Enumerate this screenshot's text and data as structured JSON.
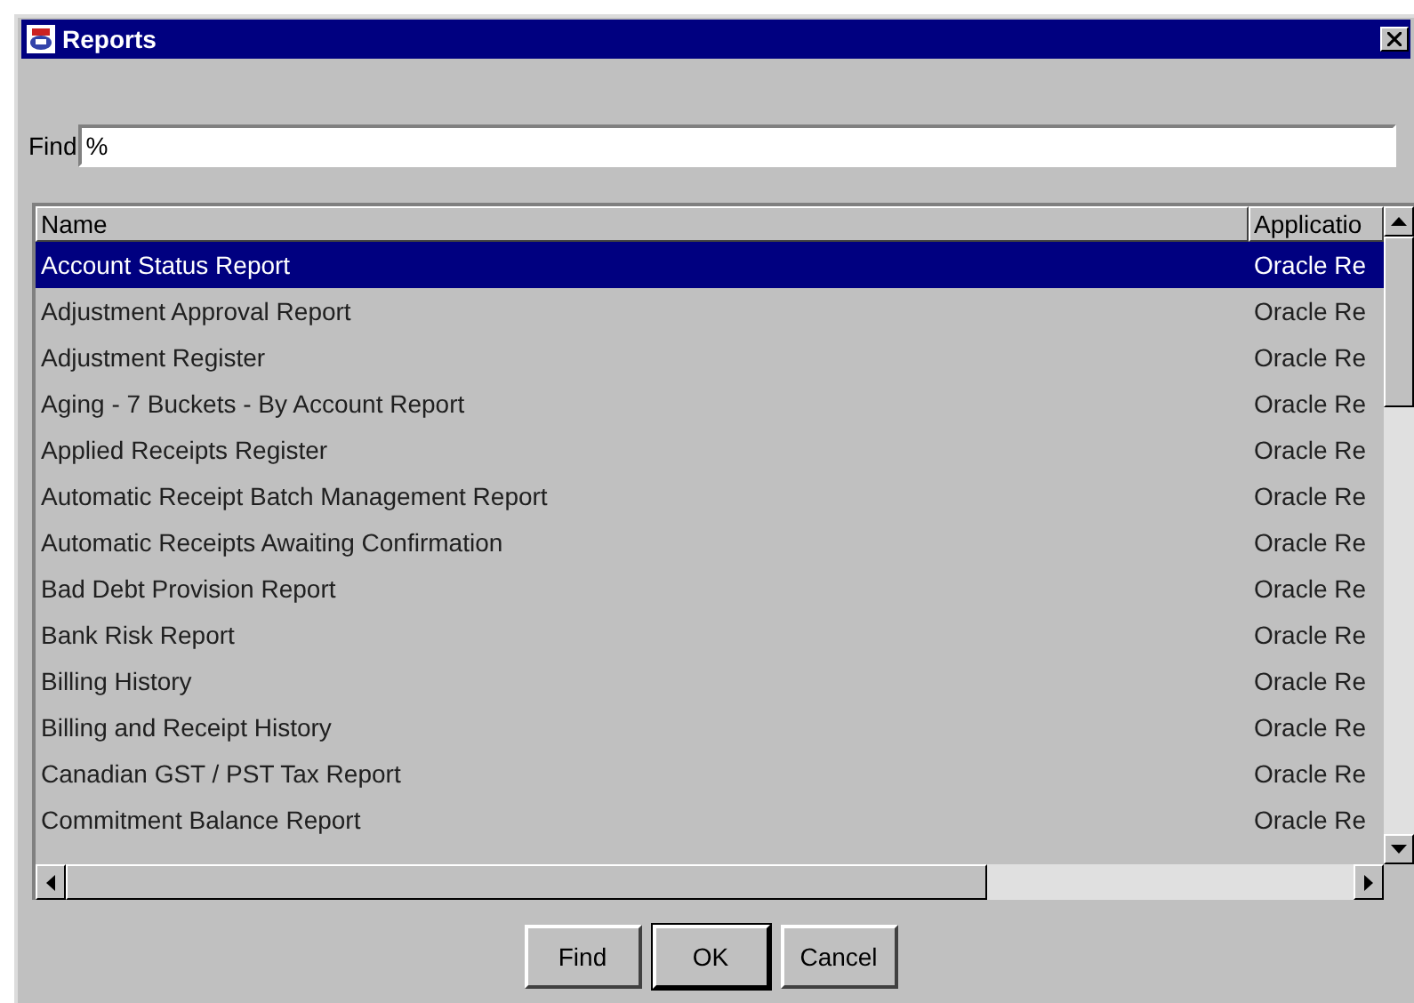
{
  "window": {
    "title": "Reports"
  },
  "find": {
    "label": "Find",
    "value": "%"
  },
  "table": {
    "columns": [
      "Name",
      "Applicatio"
    ],
    "rows": [
      {
        "name": "Account Status Report",
        "application": "Oracle Re",
        "selected": true
      },
      {
        "name": "Adjustment Approval Report",
        "application": "Oracle Re",
        "selected": false
      },
      {
        "name": "Adjustment Register",
        "application": "Oracle Re",
        "selected": false
      },
      {
        "name": "Aging - 7 Buckets - By Account Report",
        "application": "Oracle Re",
        "selected": false
      },
      {
        "name": "Applied Receipts Register",
        "application": "Oracle Re",
        "selected": false
      },
      {
        "name": "Automatic Receipt Batch Management Report",
        "application": "Oracle Re",
        "selected": false
      },
      {
        "name": "Automatic Receipts Awaiting Confirmation",
        "application": "Oracle Re",
        "selected": false
      },
      {
        "name": "Bad Debt Provision Report",
        "application": "Oracle Re",
        "selected": false
      },
      {
        "name": "Bank Risk Report",
        "application": "Oracle Re",
        "selected": false
      },
      {
        "name": "Billing History",
        "application": "Oracle Re",
        "selected": false
      },
      {
        "name": "Billing and Receipt History",
        "application": "Oracle Re",
        "selected": false
      },
      {
        "name": "Canadian GST / PST Tax Report",
        "application": "Oracle Re",
        "selected": false
      },
      {
        "name": "Commitment Balance Report",
        "application": "Oracle Re",
        "selected": false
      }
    ]
  },
  "buttons": [
    {
      "label": "Find",
      "default": false
    },
    {
      "label": "OK",
      "default": true
    },
    {
      "label": "Cancel",
      "default": false
    }
  ]
}
